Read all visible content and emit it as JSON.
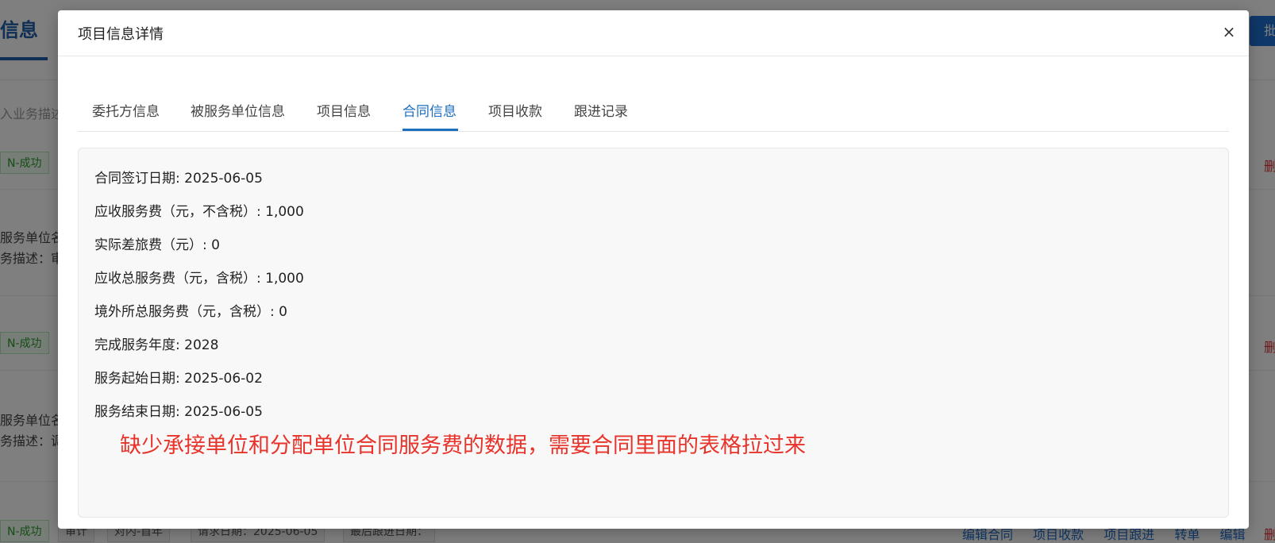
{
  "background": {
    "page_title": "信息",
    "right_button": "批",
    "search_placeholder": "入业务描述",
    "rows": [
      {
        "tag_status": "N-成功",
        "delete": "删"
      },
      {
        "line1": "服务单位名",
        "line2": "务描述：审"
      },
      {
        "tag_status": "N-成功",
        "delete": "删"
      },
      {
        "line1": "服务单位名",
        "line2": "务描述：调"
      },
      {
        "tag_status": "N-成功",
        "tag_type": "审计",
        "tag_scope": "对内-首年",
        "tag_request": "请求日期：2025-06-05",
        "tag_followup": "最后跟进日期：",
        "delete": "删"
      }
    ],
    "actions": [
      "编辑合同",
      "项目收款",
      "项目跟进",
      "转单",
      "编辑"
    ]
  },
  "modal": {
    "title": "项目信息详情",
    "close_glyph": "×",
    "tabs": [
      {
        "label": "委托方信息",
        "active": false
      },
      {
        "label": "被服务单位信息",
        "active": false
      },
      {
        "label": "项目信息",
        "active": false
      },
      {
        "label": "合同信息",
        "active": true
      },
      {
        "label": "项目收款",
        "active": false
      },
      {
        "label": "跟进记录",
        "active": false
      }
    ],
    "fields": [
      {
        "label": "合同签订日期",
        "value": "2025-06-05"
      },
      {
        "label": "应收服务费（元，不含税）",
        "value": "1,000"
      },
      {
        "label": "实际差旅费（元）",
        "value": "0"
      },
      {
        "label": "应收总服务费（元，含税）",
        "value": "1,000"
      },
      {
        "label": "境外所总服务费（元，含税）",
        "value": "0"
      },
      {
        "label": "完成服务年度",
        "value": "2028"
      },
      {
        "label": "服务起始日期",
        "value": "2025-06-02"
      },
      {
        "label": "服务结束日期",
        "value": "2025-06-05"
      }
    ],
    "annotation": "缺少承接单位和分配单位合同服务费的数据，需要合同里面的表格拉过来"
  },
  "colors": {
    "accent": "#1a6fc0",
    "success_tag": "#2e9b2e",
    "annotation_red": "#e8332a",
    "danger": "#d33333"
  }
}
